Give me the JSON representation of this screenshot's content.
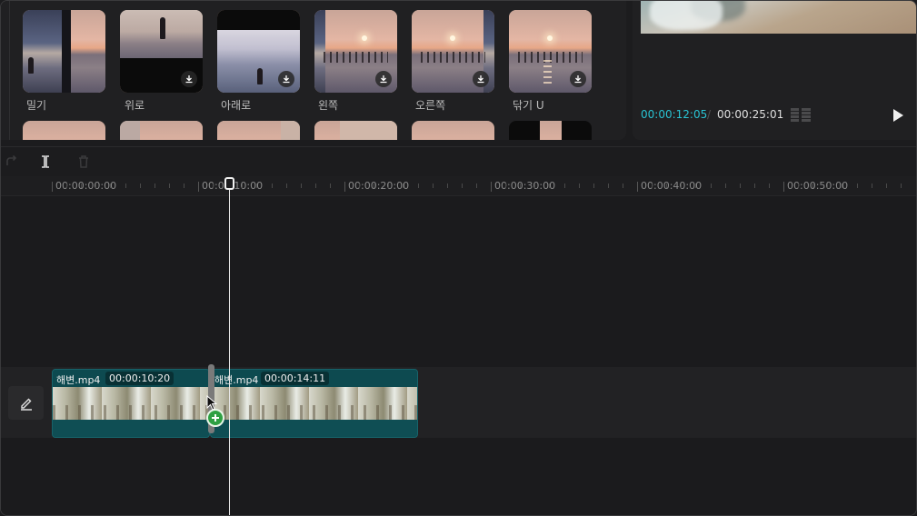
{
  "transitions": {
    "items": [
      {
        "label": "밀기",
        "icon": "transition-push-thumbnail"
      },
      {
        "label": "위로",
        "icon": "transition-up-thumbnail",
        "downloadable": true
      },
      {
        "label": "아래로",
        "icon": "transition-down-thumbnail",
        "downloadable": true
      },
      {
        "label": "왼쪽",
        "icon": "transition-left-thumbnail",
        "downloadable": true
      },
      {
        "label": "오른쪽",
        "icon": "transition-right-thumbnail",
        "downloadable": true
      },
      {
        "label": "닦기 U",
        "icon": "transition-wipe-u-thumbnail",
        "downloadable": true
      }
    ]
  },
  "preview": {
    "current_time": "00:00:12:05",
    "separator": "/",
    "total_time": "00:00:25:01",
    "accent_color": "#29c4d4"
  },
  "toolbar": {
    "icons": [
      "redo-icon",
      "split-icon",
      "delete-icon"
    ]
  },
  "timeline": {
    "ruler_labels": [
      "00:00:00:00",
      "00:00:10:00",
      "00:00:20:00",
      "00:00:30:00",
      "00:00:40:00",
      "00:00:50:00"
    ],
    "playhead_time": "00:00:12:05",
    "clips": [
      {
        "name": "해변.mp4",
        "duration": "00:00:10:20"
      },
      {
        "name": "해변.mp4",
        "duration": "00:00:14:11"
      }
    ],
    "clip_color": "#0f4e54",
    "add_transition_color": "#2ea043"
  }
}
